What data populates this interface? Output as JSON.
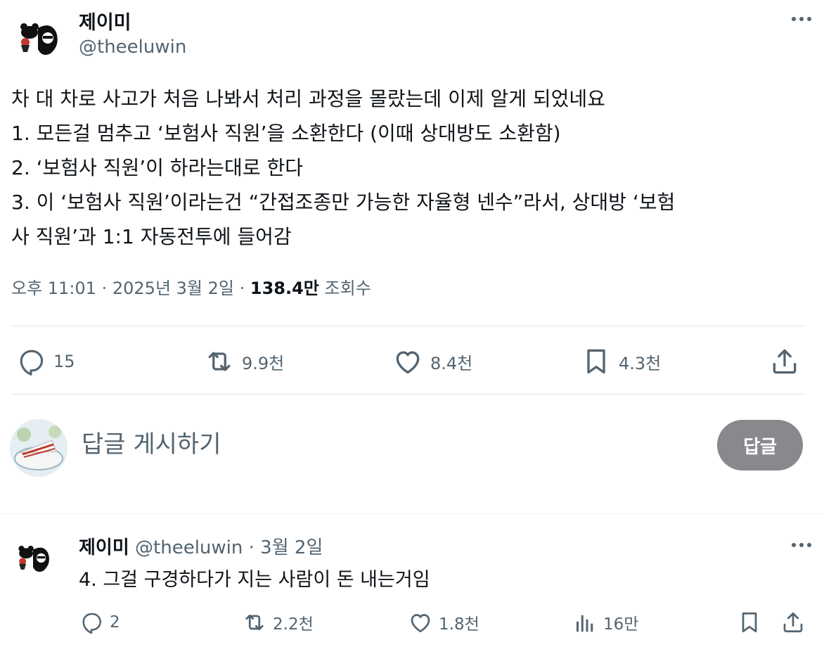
{
  "post": {
    "author": {
      "display_name": "제이미",
      "handle": "@theeluwin"
    },
    "text_lines": [
      "차 대 차로 사고가 처음 나봐서 처리 과정을 몰랐는데 이제 알게 되었네요",
      "1. 모든걸 멈추고 ‘보험사 직원’을 소환한다 (이때 상대방도 소환함)",
      "2. ‘보험사 직원’이 하라는대로 한다",
      "3. 이 ‘보험사 직원’이라는건 “간접조종만 가능한 자율형 넨수”라서, 상대방 ‘보험",
      "사 직원’과 1:1 자동전투에 들어감"
    ],
    "time": "오후 11:01",
    "date": "2025년 3월 2일",
    "views_count": "138.4만",
    "views_label": "조회수",
    "stats": {
      "replies": "15",
      "reposts": "9.9천",
      "likes": "8.4천",
      "bookmarks": "4.3천"
    }
  },
  "reply_box": {
    "placeholder": "답글 게시하기",
    "button_label": "답글"
  },
  "reply": {
    "author": {
      "display_name": "제이미",
      "handle": "@theeluwin"
    },
    "date": "3월 2일",
    "text": "4. 그걸 구경하다가 지는 사람이 돈 내는거임",
    "stats": {
      "replies": "2",
      "reposts": "2.2천",
      "likes": "1.8천",
      "views": "16만"
    }
  },
  "icons": [
    "more-icon",
    "reply-icon",
    "repost-icon",
    "like-icon",
    "bookmark-icon",
    "share-icon",
    "views-icon"
  ],
  "colors": {
    "text": "#0f1419",
    "secondary": "#536471",
    "reply_button_bg": "#87898c",
    "divider": "#e1e6ea"
  }
}
